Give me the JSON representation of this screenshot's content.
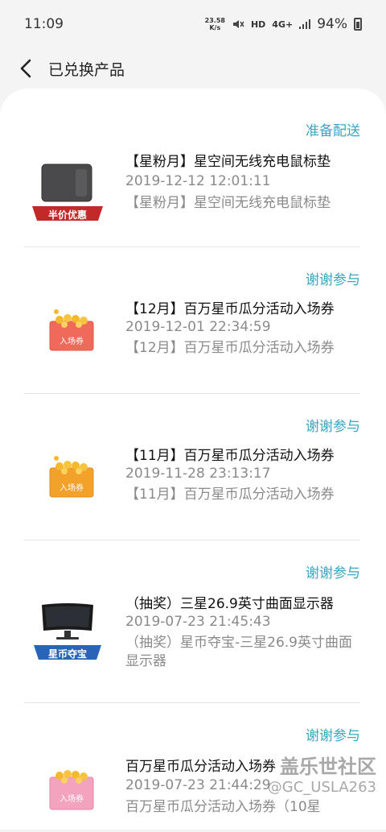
{
  "status_bar": {
    "time": "11:09",
    "net_speed": "23.58",
    "net_unit": "K/s",
    "hd": "HD",
    "network": "4G+",
    "battery": "94%"
  },
  "header": {
    "title": "已兑换产品"
  },
  "items": [
    {
      "status": "准备配送",
      "name": "【星粉月】星空间无线充电鼠标垫",
      "date": "2019-12-12 12:01:11",
      "desc": "【星粉月】星空间无线充电鼠标垫",
      "badge": "半价优惠",
      "badge_color": "#c22a2a"
    },
    {
      "status": "谢谢参与",
      "name": "【12月】百万星币瓜分活动入场券",
      "date": "2019-12-01 22:34:59",
      "desc": "【12月】百万星币瓜分活动入场券",
      "ticket_label": "入场券"
    },
    {
      "status": "谢谢参与",
      "name": "【11月】百万星币瓜分活动入场券",
      "date": "2019-11-28 23:13:17",
      "desc": "【11月】百万星币瓜分活动入场券",
      "ticket_label": "入场券"
    },
    {
      "status": "谢谢参与",
      "name": "（抽奖）三星26.9英寸曲面显示器",
      "date": "2019-07-23 21:45:43",
      "desc": "（抽奖）星币夺宝-三星26.9英寸曲面显示器",
      "badge": "星币夺宝",
      "badge_color": "#2a64b8"
    },
    {
      "status": "谢谢参与",
      "name": "百万星币瓜分活动入场券",
      "date": "2019-07-23 21:44:29",
      "desc": "百万星币瓜分活动入场券（10星",
      "ticket_label": "入场券"
    }
  ],
  "watermark": {
    "line1": "盖乐世社区",
    "line2": "@GC_USLA263"
  }
}
